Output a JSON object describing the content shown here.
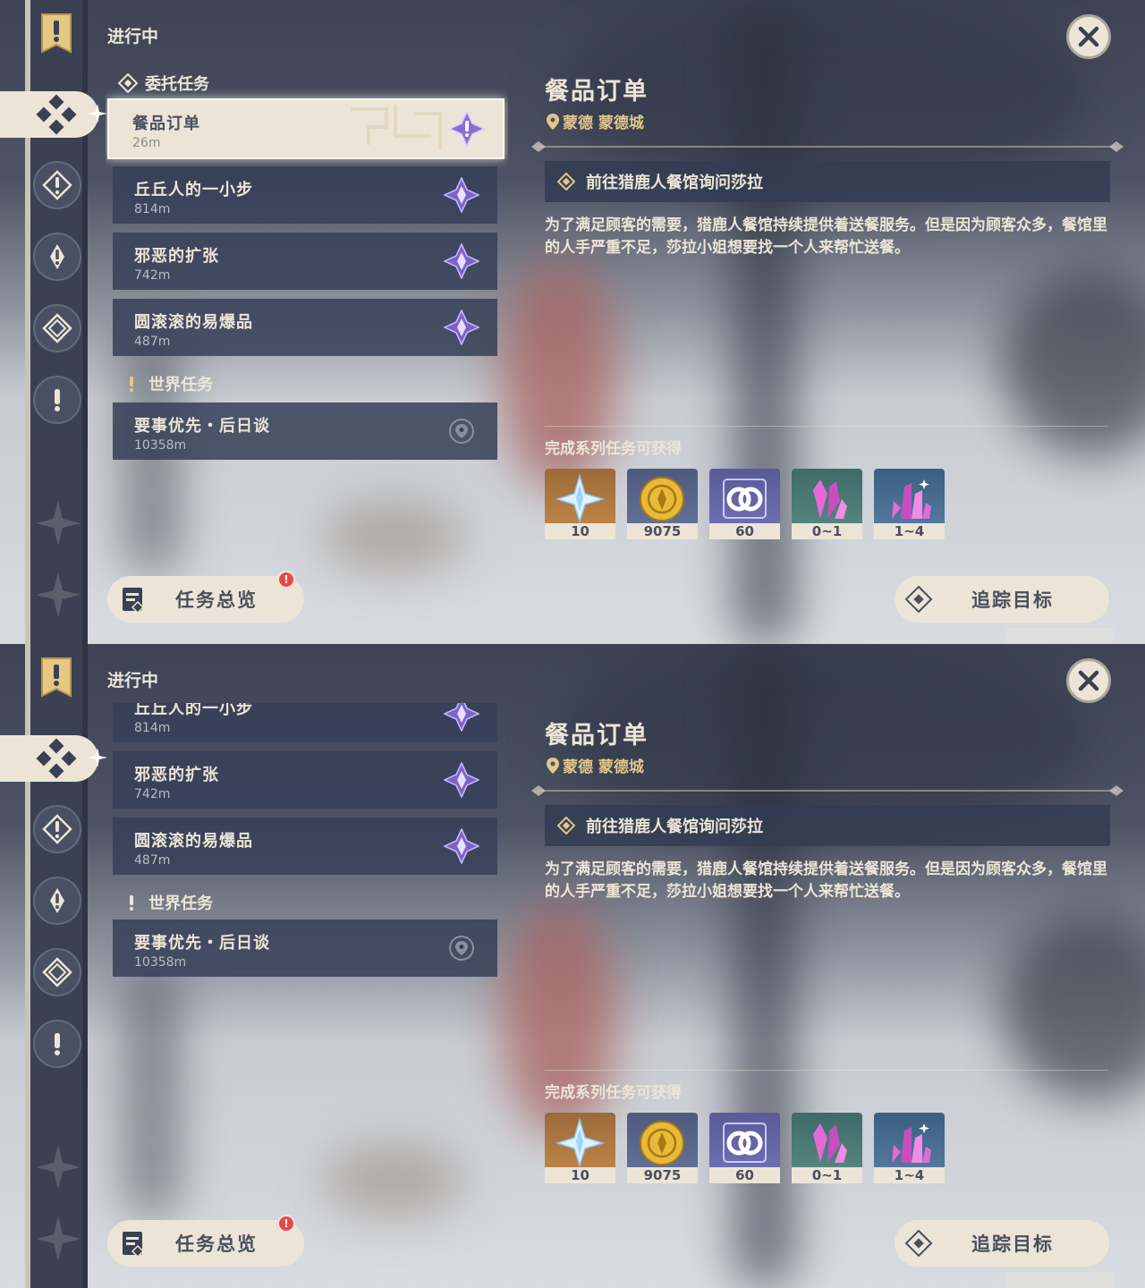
{
  "screens": [
    {
      "section_label": "进行中",
      "categories": {
        "commission": "委托任务",
        "world": "世界任务"
      },
      "quests": [
        {
          "name": "餐品订单",
          "distance": "26m",
          "selected": true
        },
        {
          "name": "丘丘人的一小步",
          "distance": "814m"
        },
        {
          "name": "邪恶的扩张",
          "distance": "742m"
        },
        {
          "name": "圆滚滚的易爆品",
          "distance": "487m"
        },
        {
          "name": "要事优先・后日谈",
          "distance": "10358m"
        }
      ],
      "detail": {
        "title": "餐品订单",
        "location": "蒙德 蒙德城",
        "objective": "前往猎鹿人餐馆询问莎拉",
        "description": "为了满足顾客的需要，猎鹿人餐馆持续提供着送餐服务。但是因为顾客众多，餐馆里的人手严重不足，莎拉小姐想要找一个人来帮忙送餐。",
        "rewards_label": "完成系列任务可获得",
        "rewards": [
          {
            "icon": "primogem-icon",
            "count": "10"
          },
          {
            "icon": "mora-icon",
            "count": "9075"
          },
          {
            "icon": "friendship-exp-icon",
            "count": "60"
          },
          {
            "icon": "crystal-chunk-icon",
            "count": "0~1"
          },
          {
            "icon": "crystal-cluster-icon",
            "count": "1~4"
          }
        ]
      },
      "buttons": {
        "overview": "任务总览",
        "track": "追踪目标",
        "badge": "!"
      }
    },
    {
      "section_label": "进行中",
      "categories": {
        "world": "世界任务"
      },
      "quests": [
        {
          "name": "丘丘人的一小步",
          "distance": "814m"
        },
        {
          "name": "邪恶的扩张",
          "distance": "742m"
        },
        {
          "name": "圆滚滚的易爆品",
          "distance": "487m"
        },
        {
          "name": "要事优先・后日谈",
          "distance": "10358m"
        }
      ],
      "detail": {
        "title": "餐品订单",
        "location": "蒙德 蒙德城",
        "objective": "前往猎鹿人餐馆询问莎拉",
        "description": "为了满足顾客的需要，猎鹿人餐馆持续提供着送餐服务。但是因为顾客众多，餐馆里的人手严重不足，莎拉小姐想要找一个人来帮忙送餐。",
        "rewards_label": "完成系列任务可获得",
        "rewards": [
          {
            "icon": "primogem-icon",
            "count": "10"
          },
          {
            "icon": "mora-icon",
            "count": "9075"
          },
          {
            "icon": "friendship-exp-icon",
            "count": "60"
          },
          {
            "icon": "crystal-chunk-icon",
            "count": "0~1"
          },
          {
            "icon": "crystal-cluster-icon",
            "count": "1~4"
          }
        ]
      },
      "buttons": {
        "overview": "任务总览",
        "track": "追踪目标",
        "badge": "!"
      }
    }
  ],
  "colors": {
    "cream": "#ece5d7",
    "panel": "#374058",
    "gold": "#e0c78b",
    "purple": "#8b6cd6",
    "badge": "#e34b4b"
  }
}
